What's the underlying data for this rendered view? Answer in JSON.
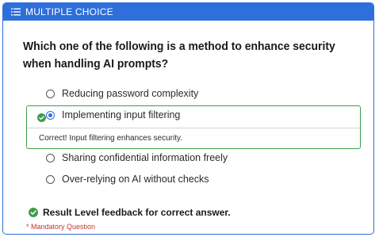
{
  "header": {
    "title": "MULTIPLE CHOICE",
    "icon": "list-icon"
  },
  "question": {
    "text": "Which one of the following is a method to enhance security when handling AI prompts?"
  },
  "options": [
    {
      "label": "Reducing password complexity",
      "selected": false
    },
    {
      "label": "Implementing input filtering",
      "selected": true,
      "correct": true
    },
    {
      "label": "Sharing confidential information freely",
      "selected": false
    },
    {
      "label": "Over-relying on AI without checks",
      "selected": false
    }
  ],
  "option_feedback": "Correct! Input filtering enhances security.",
  "result_feedback": "Result Level feedback for correct answer.",
  "mandatory_label": "* Mandatory Question",
  "colors": {
    "accent": "#2f6fdc",
    "success": "#3f9c4e",
    "error": "#c0392b"
  }
}
